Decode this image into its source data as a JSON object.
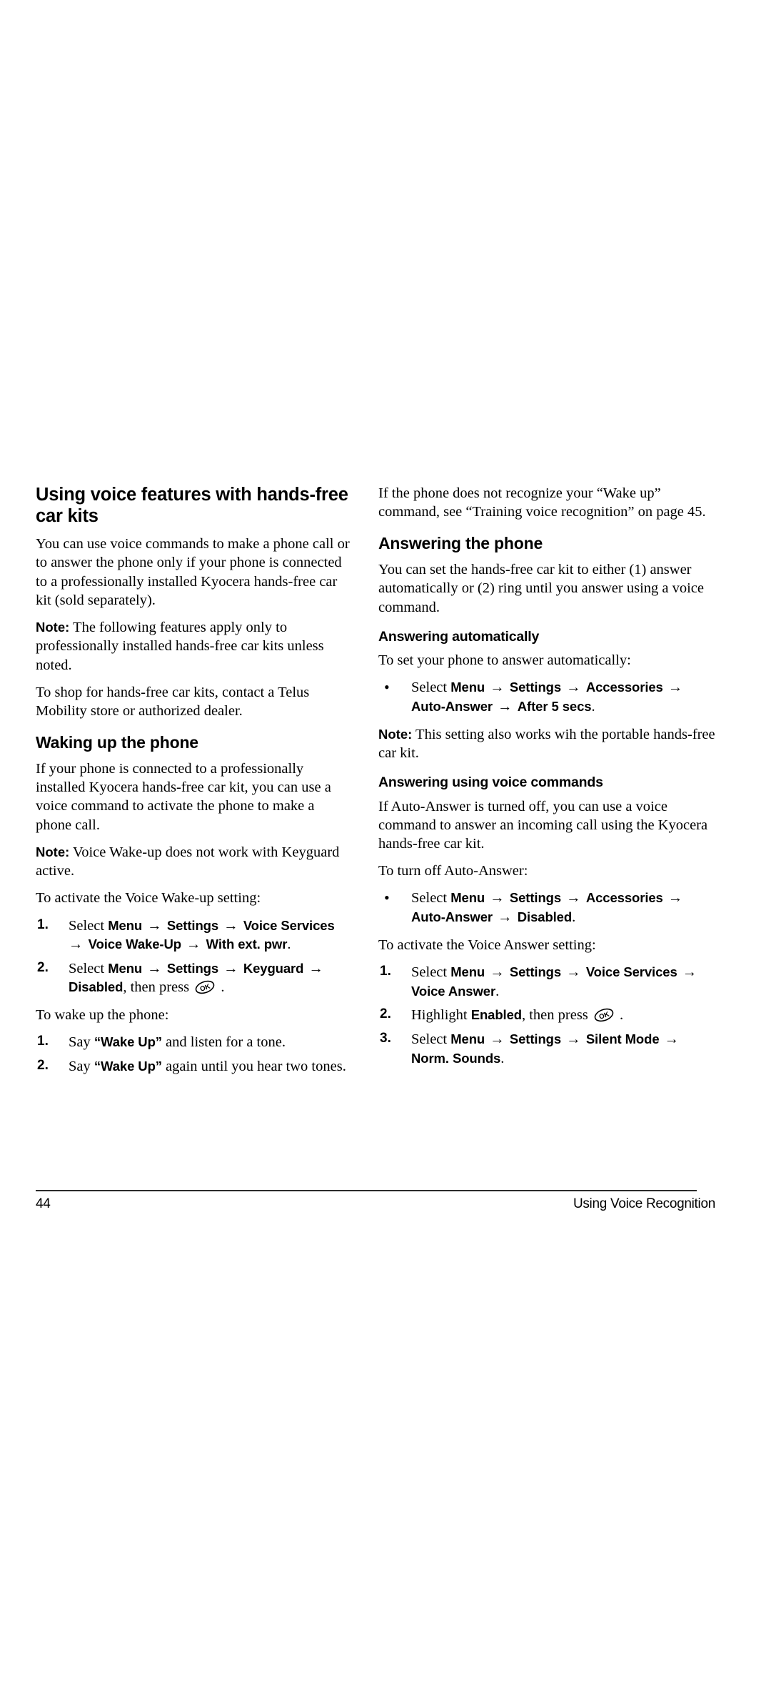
{
  "page": {
    "number": "44",
    "running_head": "Using Voice Recognition"
  },
  "left_column": {
    "title": "Using voice features with hands-free car kits",
    "intro": "You can use voice commands to make a phone call or to answer the phone only if your phone is connected to a professionally installed Kyocera hands-free car kit (sold separately).",
    "note1_label": "Note:",
    "note1_text": "The following features apply only to professionally installed hands-free car kits unless noted.",
    "shop_text": "To shop for hands-free car kits, contact a Telus Mobility store or authorized dealer.",
    "waking_heading": "Waking up the phone",
    "waking_intro": "If your phone is connected to a professionally installed Kyocera hands-free car kit, you can use a voice command to activate the phone to make a phone call.",
    "note2_label": "Note:",
    "note2_text": "Voice Wake-up does not work with Keyguard active.",
    "activate_lead": "To activate the Voice Wake-up setting:",
    "activate_steps": [
      {
        "number": "1.",
        "lead": "Select",
        "path": [
          "Menu",
          "Settings",
          "Voice Services",
          "Voice Wake-Up",
          "With ext. pwr"
        ],
        "tail": "."
      },
      {
        "number": "2.",
        "lead": "Select",
        "path": [
          "Menu",
          "Settings",
          "Keyguard",
          "Disabled"
        ],
        "tail": ", then press",
        "key_icon": "ok-key-icon",
        "end": "."
      }
    ],
    "wake_lead": "To wake up the phone:",
    "wake_steps": [
      {
        "number": "1.",
        "pre": "Say",
        "quote": "“Wake Up”",
        "post": "and listen for a tone."
      },
      {
        "number": "2.",
        "pre": "Say",
        "quote": "“Wake Up”",
        "post": "again until you hear two tones."
      }
    ]
  },
  "right_column": {
    "recognize_text": "If the phone does not recognize your “Wake up” command, see “Training voice recognition” on page 45.",
    "answering_heading": "Answering the phone",
    "answering_intro": "You can set the hands-free car kit to either (1) answer automatically or (2) ring until you answer using a voice command.",
    "auto_heading": "Answering automatically",
    "auto_lead": "To set your phone to answer automatically:",
    "auto_bullet": {
      "marker": "•",
      "lead": "Select",
      "path": [
        "Menu",
        "Settings",
        "Accessories",
        "Auto-Answer",
        "After 5 secs"
      ],
      "tail": "."
    },
    "note3_label": "Note:",
    "note3_text": "This setting also works wih the portable hands-free car kit.",
    "voice_cmd_heading": "Answering using voice commands",
    "voice_cmd_intro": "If Auto-Answer is turned off, you can use a voice command to answer an incoming call using the Kyocera hands-free car kit.",
    "turnoff_lead": "To turn off Auto-Answer:",
    "turnoff_bullet": {
      "marker": "•",
      "lead": "Select",
      "path": [
        "Menu",
        "Settings",
        "Accessories",
        "Auto-Answer",
        "Disabled"
      ],
      "tail": "."
    },
    "voice_answer_lead": "To activate the Voice Answer setting:",
    "voice_answer_steps": [
      {
        "number": "1.",
        "lead": "Select",
        "path": [
          "Menu",
          "Settings",
          "Voice Services",
          "Voice Answer"
        ],
        "tail": "."
      },
      {
        "number": "2.",
        "lead": "Highlight",
        "path": [
          "Enabled"
        ],
        "tail": ", then press",
        "key_icon": "ok-key-icon",
        "end": "."
      },
      {
        "number": "3.",
        "lead": "Select",
        "path": [
          "Menu",
          "Settings",
          "Silent Mode",
          "Norm. Sounds"
        ],
        "tail": "."
      }
    ]
  },
  "symbols": {
    "arrow": "→",
    "bullet": "•",
    "ok_key_label": "OK"
  }
}
